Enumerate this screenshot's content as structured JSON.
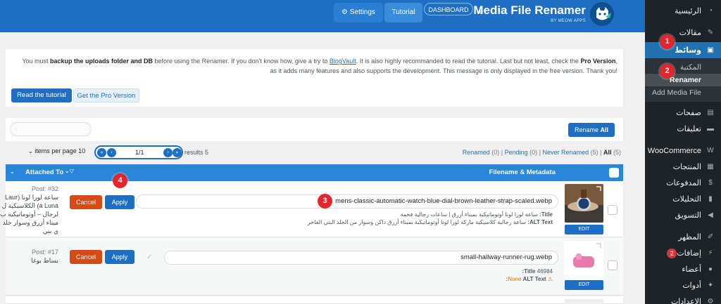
{
  "header": {
    "title": "Media File Renamer",
    "subtitle": "BY MEOW APPS",
    "tabs": [
      "Settings",
      "Tutorial"
    ],
    "dashboard": "DASHBOARD"
  },
  "notice": {
    "text_a": "You must ",
    "text_b": "backup the uploads folder and DB",
    "text_c": " before using the Renamer. If you don't know how, give a try to ",
    "link": "BlogVault",
    "text_d": ". It is also highly recommanded to read the tutorial. Last but not least, check the ",
    "text_e": "Pro Version",
    "text_f": ", as it adds many features and also supports the development. This message is only displayed in the free version. Thank you!",
    "read_tutorial": "Read the tutorial",
    "get_pro": "Get the Pro Version"
  },
  "toolbar": {
    "rename_all_a": "Rename ",
    "rename_all_b": "All"
  },
  "pager": {
    "per_page": "items per page 10",
    "page": "1/1",
    "results": "results 5"
  },
  "filters": {
    "renamed": "Renamed",
    "renamed_count": "(0)",
    "pending": "Pending",
    "pending_count": "(0)",
    "never": "Never Renamed",
    "never_count": "(5)",
    "all": "All",
    "all_count": "(5)",
    "sep": "|"
  },
  "table": {
    "col_attached": "Attached To",
    "col_filename": "Filename & Metadata",
    "rows": [
      {
        "filename": "mens-classic-automatic-watch-blue-dial-brown-leather-strap-scaled.webp",
        "title_label": "Title:",
        "title": "ساعة لورا لونا أوتوماتيكية بميناء أزرق | ساعات رجالية فخمة",
        "alt_label": "ALT Text:",
        "alt": "ساعة رجالية كلاسيكية ماركة لورا لونا أوتوماتيكية بميناء أزرق داكن وسوار من الجلد البني الفاخر",
        "post": "Post: #32",
        "attached_lines": [
          "ساعة لورا لونا (Laur",
          "a Luna) الكلاسيكية ل",
          "لرجال – أوتوماتيكية ب",
          "ميناء أزرق وسوار جلد",
          "ي بني"
        ],
        "cancel": "Cancel",
        "apply": "Apply",
        "edit": "EDIT"
      },
      {
        "filename": "small-hallway-runner-rug.webp",
        "title_label": "Title:",
        "title": "46984",
        "alt_label": "ALT Text:",
        "alt": "None",
        "post": "Post: #17",
        "attached_lines": [
          "بساط بوغا"
        ],
        "cancel": "Cancel",
        "apply": "Apply",
        "edit": "EDIT"
      }
    ]
  },
  "sidebar": {
    "items": [
      {
        "label": "الرئيسية",
        "icon": "dashboard-icon"
      },
      {
        "label": "مقالات",
        "icon": "pin-icon"
      },
      {
        "label": "وسائط",
        "icon": "media-icon"
      },
      {
        "label": "صفحات",
        "icon": "page-icon"
      },
      {
        "label": "تعليقات",
        "icon": "comment-icon"
      },
      {
        "label": "WooCommerce",
        "icon": "woo-icon"
      },
      {
        "label": "المنتجات",
        "icon": "archive-icon"
      },
      {
        "label": "المدفوعات",
        "icon": "dollar-icon"
      },
      {
        "label": "التحليلات",
        "icon": "bar-chart-icon"
      },
      {
        "label": "التسويق",
        "icon": "megaphone-icon"
      },
      {
        "label": "المظهر",
        "icon": "brush-icon"
      },
      {
        "label": "إضافات",
        "icon": "plugin-icon",
        "badge": "2"
      },
      {
        "label": "أعضاء",
        "icon": "user-icon"
      },
      {
        "label": "أدوات",
        "icon": "wrench-icon"
      },
      {
        "label": "الإعدادات",
        "icon": "settings-icon"
      }
    ],
    "submenu": [
      "المكتبة",
      "Renamer",
      "Add Media File"
    ]
  },
  "steps": [
    "1",
    "2",
    "3",
    "4"
  ],
  "colors": {
    "accent": "#1e6fc4",
    "danger": "#d64a16",
    "marker": "#e4252b",
    "sidebar": "#1d2327"
  }
}
